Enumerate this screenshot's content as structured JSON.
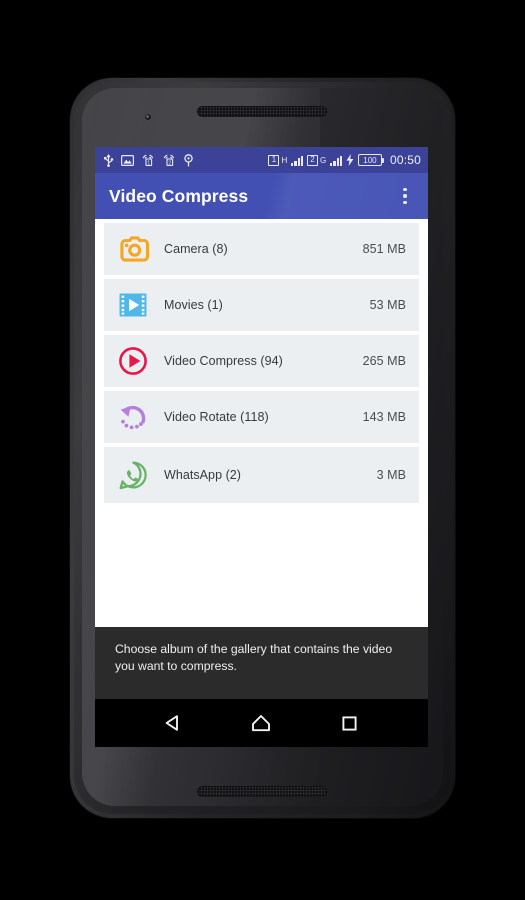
{
  "device": {
    "hardware": {
      "front_camera": "camera-dot",
      "earpiece_speaker": "speaker-grille-top",
      "bottom_speaker": "speaker-grille-bottom"
    }
  },
  "status_bar": {
    "left_icons": [
      {
        "name": "usb-icon",
        "label": "USB"
      },
      {
        "name": "screenshot-icon",
        "label": "Screenshot"
      },
      {
        "name": "sim1-signal-icon",
        "label": "SIM 1"
      },
      {
        "name": "sim2-signal-icon",
        "label": "SIM 2"
      },
      {
        "name": "location-icon",
        "label": "GPS"
      }
    ],
    "sim1": {
      "badge": "1",
      "network": "H"
    },
    "sim2": {
      "badge": "2",
      "network": "G"
    },
    "charging": true,
    "battery_level": "100",
    "clock": "00:50",
    "background_color": "#3b4297"
  },
  "app_bar": {
    "title": "Video Compress",
    "overflow_label": "More options",
    "background_color": "#4250b4",
    "text_color": "#ffffff"
  },
  "albums": [
    {
      "name": "Camera (8)",
      "size": "851 MB",
      "icon": "camera-icon",
      "icon_color": "#f5a623"
    },
    {
      "name": "Movies (1)",
      "size": "53 MB",
      "icon": "film-play-icon",
      "icon_color": "#4fb8e8"
    },
    {
      "name": "Video Compress (94)",
      "size": "265 MB",
      "icon": "play-circle-icon",
      "icon_color": "#e8174b"
    },
    {
      "name": "Video Rotate (118)",
      "size": "143 MB",
      "icon": "rotate-icon",
      "icon_color": "#b47fe0"
    },
    {
      "name": "WhatsApp (2)",
      "size": "3 MB",
      "icon": "whatsapp-icon",
      "icon_color": "#68b267"
    }
  ],
  "hint": {
    "text": "Choose album of the gallery that contains the video you want to compress.",
    "background_color": "#2b2b2b",
    "text_color": "#efefef"
  },
  "nav_bar": {
    "back_label": "Back",
    "home_label": "Home",
    "recents_label": "Recents",
    "background_color": "#000000"
  }
}
